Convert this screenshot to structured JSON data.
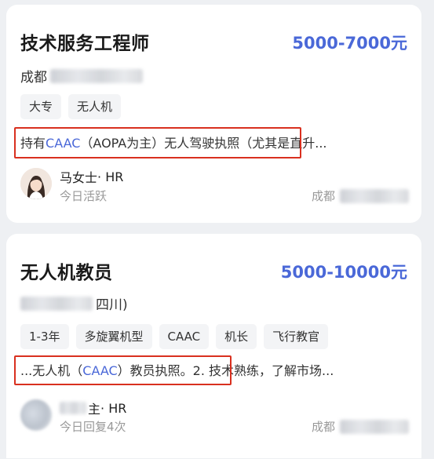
{
  "jobs": [
    {
      "title": "技术服务工程师",
      "salary": "5000-7000元",
      "location_prefix": "成都",
      "location_suffix": "",
      "tags": [
        "大专",
        "无人机"
      ],
      "desc_before": "持有",
      "desc_highlight": "CAAC",
      "desc_after": "（AOPA为主）无人驾驶执照（尤其是直升...",
      "hr_name_prefix": "马女士",
      "hr_role": " · HR",
      "hr_status": "今日活跃",
      "footer_location": "成都"
    },
    {
      "title": "无人机教员",
      "salary": "5000-10000元",
      "location_prefix": "",
      "location_suffix": "四川)",
      "tags": [
        "1-3年",
        "多旋翼机型",
        "CAAC",
        "机长",
        "飞行教官"
      ],
      "desc_before": "...无人机（",
      "desc_highlight": "CAAC",
      "desc_after": "）教员执照。2. 技术熟练，了解市场...",
      "hr_name_prefix": "主",
      "hr_role": " · HR",
      "hr_status": "今日回复4次",
      "footer_location": "成都"
    }
  ],
  "colors": {
    "accent": "#4a68d8",
    "highlight_box": "#d9301f",
    "background": "#eef0f3"
  }
}
